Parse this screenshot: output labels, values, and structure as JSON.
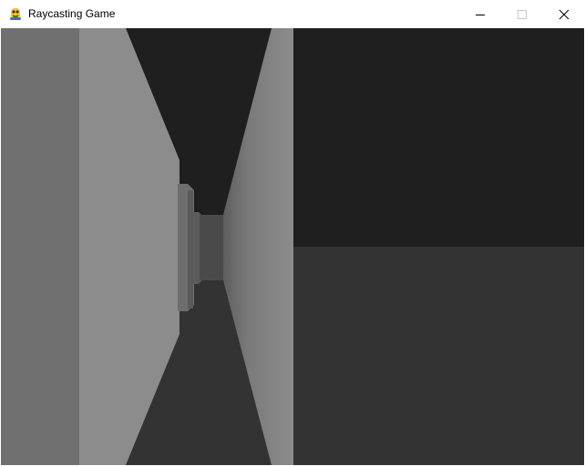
{
  "window": {
    "title": "Raycasting Game",
    "icon": "pygame-snake-icon"
  },
  "caption_buttons": {
    "minimize": "minimize-icon",
    "maximize": "maximize-icon",
    "close": "close-icon"
  },
  "scene": {
    "ceiling_color": "#1f1f1f",
    "floor_color": "#333333",
    "wall_light_color": "#8c8c8c",
    "wall_mid_color": "#6e6e6e",
    "wall_dark_color": "#4a4a4a"
  }
}
